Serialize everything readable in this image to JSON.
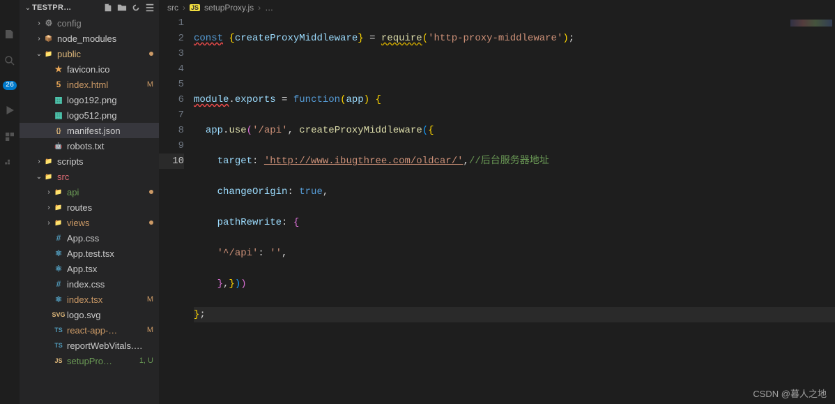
{
  "activity": {
    "badge": "26"
  },
  "sidebar": {
    "title": "TESTPR…",
    "tree": [
      {
        "indent": 1,
        "chev": "›",
        "icon": "⚙",
        "iconClass": "fc-gray",
        "label": "config",
        "labelClass": "fc-gray"
      },
      {
        "indent": 1,
        "chev": "›",
        "icon": "📦",
        "iconClass": "fc-green",
        "label": "node_modules"
      },
      {
        "indent": 1,
        "chev": "⌄",
        "icon": "📁",
        "iconClass": "fc-yellow",
        "label": "public",
        "labelClass": "lbl-yellow",
        "dot": true
      },
      {
        "indent": 2,
        "icon": "★",
        "iconClass": "fc-orange",
        "label": "favicon.ico"
      },
      {
        "indent": 2,
        "icon": "5",
        "iconClass": "fc-orange",
        "label": "index.html",
        "labelClass": "lbl-mod",
        "status": "M"
      },
      {
        "indent": 2,
        "icon": "▦",
        "iconClass": "fc-teal",
        "label": "logo192.png"
      },
      {
        "indent": 2,
        "icon": "▦",
        "iconClass": "fc-teal",
        "label": "logo512.png"
      },
      {
        "indent": 2,
        "icon": "{}",
        "iconClass": "fc-yellow",
        "label": "manifest.json",
        "selected": true
      },
      {
        "indent": 2,
        "icon": "🤖",
        "iconClass": "fc-red",
        "label": "robots.txt"
      },
      {
        "indent": 1,
        "chev": "›",
        "icon": "📁",
        "iconClass": "fc-green",
        "label": "scripts"
      },
      {
        "indent": 1,
        "chev": "⌄",
        "icon": "📁",
        "iconClass": "fc-red",
        "label": "src",
        "labelClass": "lbl-red"
      },
      {
        "indent": 2,
        "chev": "›",
        "icon": "📁",
        "iconClass": "fc-green",
        "label": "api",
        "labelClass": "lbl-green",
        "dot": true
      },
      {
        "indent": 2,
        "chev": "›",
        "icon": "📁",
        "iconClass": "fc-purple",
        "label": "routes"
      },
      {
        "indent": 2,
        "chev": "›",
        "icon": "📁",
        "iconClass": "fc-red",
        "label": "views",
        "labelClass": "lbl-mod",
        "dot": true
      },
      {
        "indent": 2,
        "icon": "#",
        "iconClass": "fc-blue",
        "label": "App.css"
      },
      {
        "indent": 2,
        "icon": "⚛",
        "iconClass": "fc-blue",
        "label": "App.test.tsx"
      },
      {
        "indent": 2,
        "icon": "⚛",
        "iconClass": "fc-blue",
        "label": "App.tsx"
      },
      {
        "indent": 2,
        "icon": "#",
        "iconClass": "fc-blue",
        "label": "index.css"
      },
      {
        "indent": 2,
        "icon": "⚛",
        "iconClass": "fc-blue",
        "label": "index.tsx",
        "labelClass": "lbl-mod",
        "status": "M"
      },
      {
        "indent": 2,
        "icon": "SVG",
        "iconClass": "fc-yellow",
        "label": "logo.svg"
      },
      {
        "indent": 2,
        "icon": "TS",
        "iconClass": "fc-blue",
        "label": "react-app-…",
        "labelClass": "lbl-mod",
        "status": "M"
      },
      {
        "indent": 2,
        "icon": "TS",
        "iconClass": "fc-blue",
        "label": "reportWebVitals.…"
      },
      {
        "indent": 2,
        "icon": "JS",
        "iconClass": "fc-yellow",
        "label": "setupPro…",
        "labelClass": "lbl-green",
        "status": "1, U"
      }
    ]
  },
  "breadcrumb": {
    "p1": "src",
    "p2": "setupProxy.js",
    "p3": "…",
    "jsTag": "JS"
  },
  "code": {
    "lines": [
      "1",
      "2",
      "3",
      "4",
      "5",
      "6",
      "7",
      "8",
      "9",
      "10"
    ],
    "l1": {
      "const": "const",
      "create": "createProxyMiddleware",
      "eq": " = ",
      "req": "require",
      "str": "'http-proxy-middleware'"
    },
    "l3": {
      "mod": "module",
      "exp": "exports",
      "eq": " = ",
      "fn": "function",
      "app": "app"
    },
    "l4": {
      "app": "app",
      "use": "use",
      "api": "'/api'",
      "create": "createProxyMiddleware"
    },
    "l5": {
      "target": "target",
      "url": "'http://www.ibugthree.com/oldcar/'",
      "cm": "//后台服务器地址"
    },
    "l6": {
      "co": "changeOrigin",
      "true": "true"
    },
    "l7": {
      "pr": "pathRewrite"
    },
    "l8": {
      "k": "'^/api'",
      "v": "''"
    }
  },
  "watermark": "CSDN @暮人之地"
}
